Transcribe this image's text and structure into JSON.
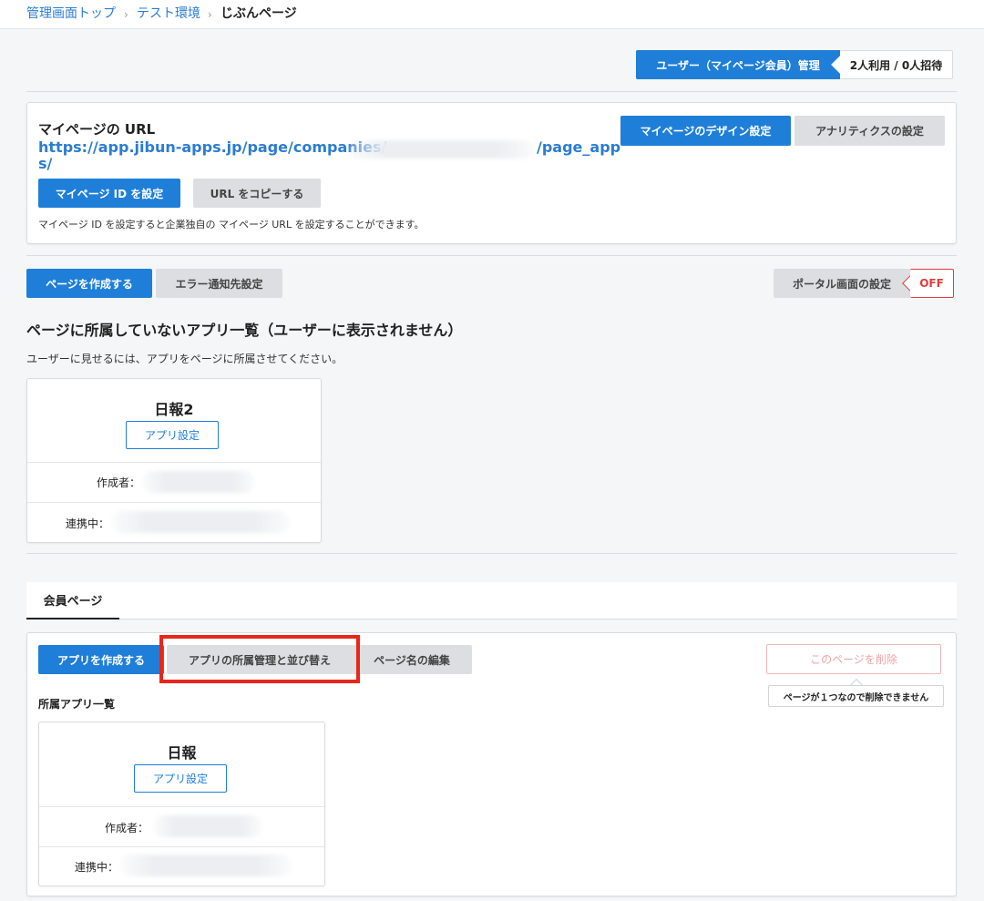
{
  "breadcrumb": {
    "home": "管理画面トップ",
    "env": "テスト環境",
    "current": "じぶんページ",
    "separator": "›"
  },
  "user_mgmt": {
    "button_label": "ユーザー（マイページ会員）管理",
    "count_label": "2人利用 / 0人招待"
  },
  "mypage_url": {
    "title": "マイページの URL",
    "url_line1_start": "https://app.jibun-apps.jp/page/companies/",
    "url_line1_end": "/page_app",
    "url_line2": "s/",
    "set_id_button": "マイページ ID を設定",
    "copy_button": "URL をコピーする",
    "note": "マイページ ID を設定すると企業独自の マイページ URL を設定することができます。",
    "design_button": "マイページのデザイン設定",
    "analytics_button": "アナリティクスの設定"
  },
  "toolbar": {
    "create_page_button": "ページを作成する",
    "error_notify_button": "エラー通知先設定",
    "portal_settings_label": "ポータル画面の設定",
    "portal_status": "OFF"
  },
  "unassigned": {
    "heading": "ページに所属していないアプリ一覧（ユーザーに表示されません）",
    "subtext": "ユーザーに見せるには、アプリをページに所属させてください。",
    "app": {
      "name": "日報2",
      "settings_button": "アプリ設定",
      "creator_label": "作成者：",
      "linked_label": "連携中："
    }
  },
  "member_page": {
    "tab_label": "会員ページ",
    "create_app_button": "アプリを作成する",
    "manage_button": "アプリの所属管理と並び替え",
    "rename_button": "ページ名の編集",
    "delete_button": "このページを削除",
    "delete_tooltip": "ページが１つなので削除できません",
    "apps_heading": "所属アプリ一覧",
    "app": {
      "name": "日報",
      "settings_button": "アプリ設定",
      "creator_label": "作成者：",
      "linked_label": "連携中："
    }
  },
  "colors": {
    "accent": "#1f7fd8",
    "highlight": "#e8261a",
    "off_red": "#e23b3b"
  }
}
